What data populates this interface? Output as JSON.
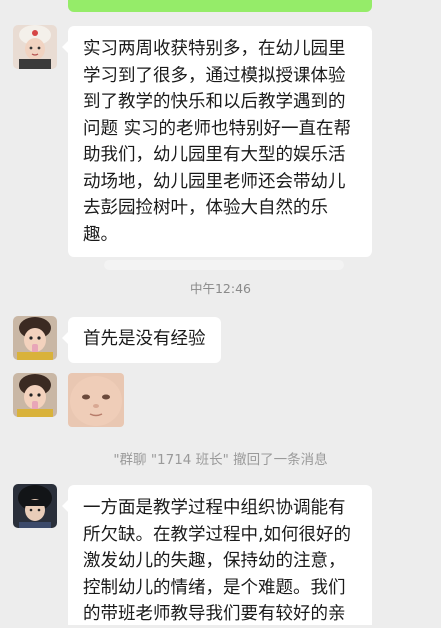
{
  "chat": {
    "timestamp": "中午12:46",
    "system_message": "\"群聊 \"1714 班长\" 撤回了一条消息",
    "messages": [
      {
        "sender": "girl-with-hat",
        "lines": [
          "实习两周收获特别多，在幼儿园里",
          "学习到了很多，通过模拟授课体验",
          "到了教学的快乐和以后教学遇到的",
          "问题 实习的老师也特别好一直在帮",
          "助我们，幼儿园里有大型的娱乐活",
          "动场地，幼儿园里老师还会带幼儿",
          "去彭园捡树叶，体验大自然的乐",
          "趣。"
        ]
      },
      {
        "sender": "toddler-photo",
        "lines": [
          "首先是没有经验"
        ]
      },
      {
        "sender": "toddler-photo",
        "type": "image",
        "image_desc": "baby face photo"
      },
      {
        "sender": "dark-hair-avatar",
        "lines": [
          "一方面是教学过程中组织协调能有",
          "所欠缺。在教学过程中,如何很好的",
          "激发幼儿的失趣，保持幼的注意，",
          "控制幼儿的情绪，是个难题。我们",
          "的带班老师教导我们要有较好的亲"
        ]
      }
    ]
  },
  "colors": {
    "background": "#ededed",
    "bubble_received": "#ffffff",
    "bubble_sent": "#95ec69",
    "meta_text": "#8a8a8a"
  }
}
